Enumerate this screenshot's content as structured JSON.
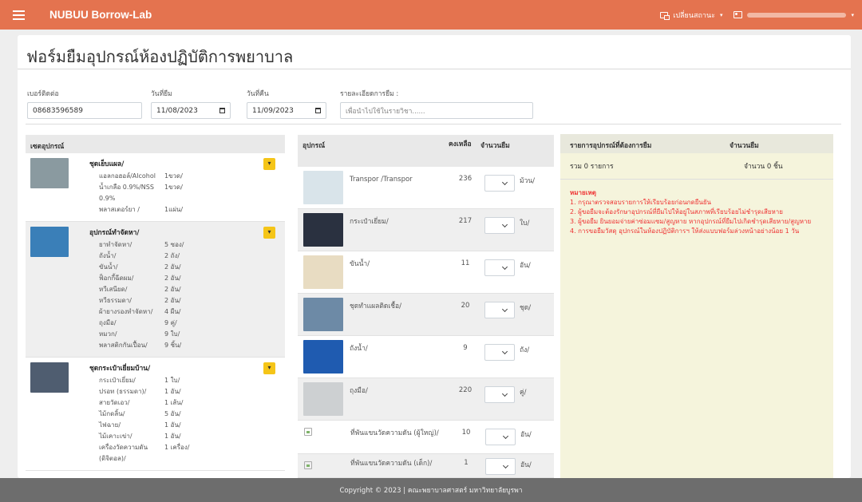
{
  "navbar": {
    "brand": "NUBUU Borrow-Lab",
    "lang_label": "เปลี่ยนสถานะ"
  },
  "page": {
    "title": "ฟอร์มยืมอุปกรณ์ห้องปฏิบัติการพยาบาล"
  },
  "form": {
    "phone": {
      "label": "เบอร์ติดต่อ",
      "value": "08683596589"
    },
    "borrow_date": {
      "label": "วันที่ยืม",
      "value": "11/08/2023"
    },
    "return_date": {
      "label": "วันที่คืน",
      "value": "11/09/2023"
    },
    "details": {
      "label": "รายละเอียดการยืม :",
      "placeholder": "เพื่อนำไปใช้ในรายวิชา......"
    }
  },
  "sets": {
    "header": "เซตอุปกรณ์",
    "add_icon": "chevron-down-icon",
    "list": [
      {
        "name": "ชุดเย็บแผล/",
        "thumb_color": "#8a9aa0",
        "items": [
          {
            "n": "แอลกอฮอล์/Alcohol",
            "q": "1ขวด/"
          },
          {
            "n": "น้ำเกลือ 0.9%/NSS 0.9%",
            "q": "1ขวด/"
          },
          {
            "n": "พลาสเตอร์ยา /",
            "q": "1แผ่น/"
          }
        ]
      },
      {
        "name": "อุปกรณ์ทำจัดหา/",
        "thumb_color": "#3a7fb8",
        "items": [
          {
            "n": "ยาทำจัดหา/",
            "q": "5 ซอง/"
          },
          {
            "n": "ถังน้ำ/",
            "q": "2 ถัง/"
          },
          {
            "n": "ขันน้ำ/",
            "q": "2 อัน/"
          },
          {
            "n": "ฟ็อกกี้ฉีดผม/",
            "q": "2 อัน/"
          },
          {
            "n": "หวีเสนียด/",
            "q": "2 อัน/"
          },
          {
            "n": "หวีธรรมดา/",
            "q": "2 อัน/"
          },
          {
            "n": "ผ้ายางรองทำจัดหา/",
            "q": "4 ผืน/"
          },
          {
            "n": "ถุงมือ/",
            "q": "9 คู่/"
          },
          {
            "n": "หมวก/",
            "q": "9 ใบ/"
          },
          {
            "n": "พลาสติกกันเปื้อน/",
            "q": "9 ชิ้น/"
          }
        ]
      },
      {
        "name": "ชุดกระเป๋าเยี่ยมบ้าน/",
        "thumb_color": "#4f5d70",
        "items": [
          {
            "n": "กระเป๋าเยี่ยม/",
            "q": "1 ใบ/"
          },
          {
            "n": "ปรอท (ธรรมดา)/",
            "q": "1 อัน/"
          },
          {
            "n": "สายวัดเอว/",
            "q": "1 เส้น/"
          },
          {
            "n": "ไม้กดลิ้น/",
            "q": "5 อัน/"
          },
          {
            "n": "ไฟฉาย/",
            "q": "1 อัน/"
          },
          {
            "n": "ไม้เคาะเข่า/",
            "q": "1 อัน/"
          },
          {
            "n": "เครื่องวัดความดัน (ดิจิตอล)/",
            "q": "1 เครื่อง/"
          }
        ]
      }
    ]
  },
  "equipment": {
    "headers": {
      "name": "อุปกรณ์",
      "stock": "คงเหลือ",
      "qty": "จำนวนยืม"
    },
    "rows": [
      {
        "name": "Transpor /Transpor",
        "stock": "236",
        "unit": "ม้วน/",
        "thumb_color": "#d9e4ea"
      },
      {
        "name": "กระเป๋าเยี่ยม/",
        "stock": "217",
        "unit": "ใบ/",
        "thumb_color": "#2a3140"
      },
      {
        "name": "ขันน้ำ/",
        "stock": "11",
        "unit": "อัน/",
        "thumb_color": "#e8dcc2"
      },
      {
        "name": "ชุดทำแผลติดเชื้อ/",
        "stock": "20",
        "unit": "ชุด/",
        "thumb_color": "#6d8aa6"
      },
      {
        "name": "ถังน้ำ/",
        "stock": "9",
        "unit": "ถัง/",
        "thumb_color": "#1f5bb0"
      },
      {
        "name": "ถุงมือ/",
        "stock": "220",
        "unit": "คู่/",
        "thumb_color": "#cdd0d2"
      },
      {
        "name": "ที่พันแขนวัดความดัน (ผู้ใหญ่)/",
        "stock": "10",
        "unit": "อัน/"
      },
      {
        "name": "ที่พันแขนวัดความดัน (เด็ก)/",
        "stock": "1",
        "unit": "อัน/"
      }
    ]
  },
  "cart": {
    "header_items": "รายการอุปกรณ์ที่ต้องการยืม",
    "header_qty": "จำนวนยืม",
    "total_items": "รวม 0 รายการ",
    "total_qty": "จำนวน 0 ชิ้น",
    "notes_title": "หมายเหตุ",
    "notes": [
      "1. กรุณาตรวจสอบรายการให้เรียบร้อยก่อนกดยืนยัน",
      "2. ผู้ขอยืมจะต้องรักษาอุปกรณ์ที่ยืมไปให้อยู่ในสภาพที่เรียบร้อยไม่ชำรุดเสียหาย",
      "3. ผู้ขอยืม ยินยอมจ่ายค่าซ่อมแซม/สูญหาย หากอุปกรณ์ที่ยืมไปเกิดชำรุดเสียหาย/สูญหาย",
      "4. การขอยืมวัสดุ อุปกรณ์ในห้องปฏิบัติการฯ ให้ส่งแบบฟอร์มล่วงหน้าอย่างน้อย 1 วัน"
    ]
  },
  "footer": {
    "text": "Copyright © 2023 | คณะพยาบาลศาสตร์ มหาวิทยาลัยบูรพา"
  }
}
